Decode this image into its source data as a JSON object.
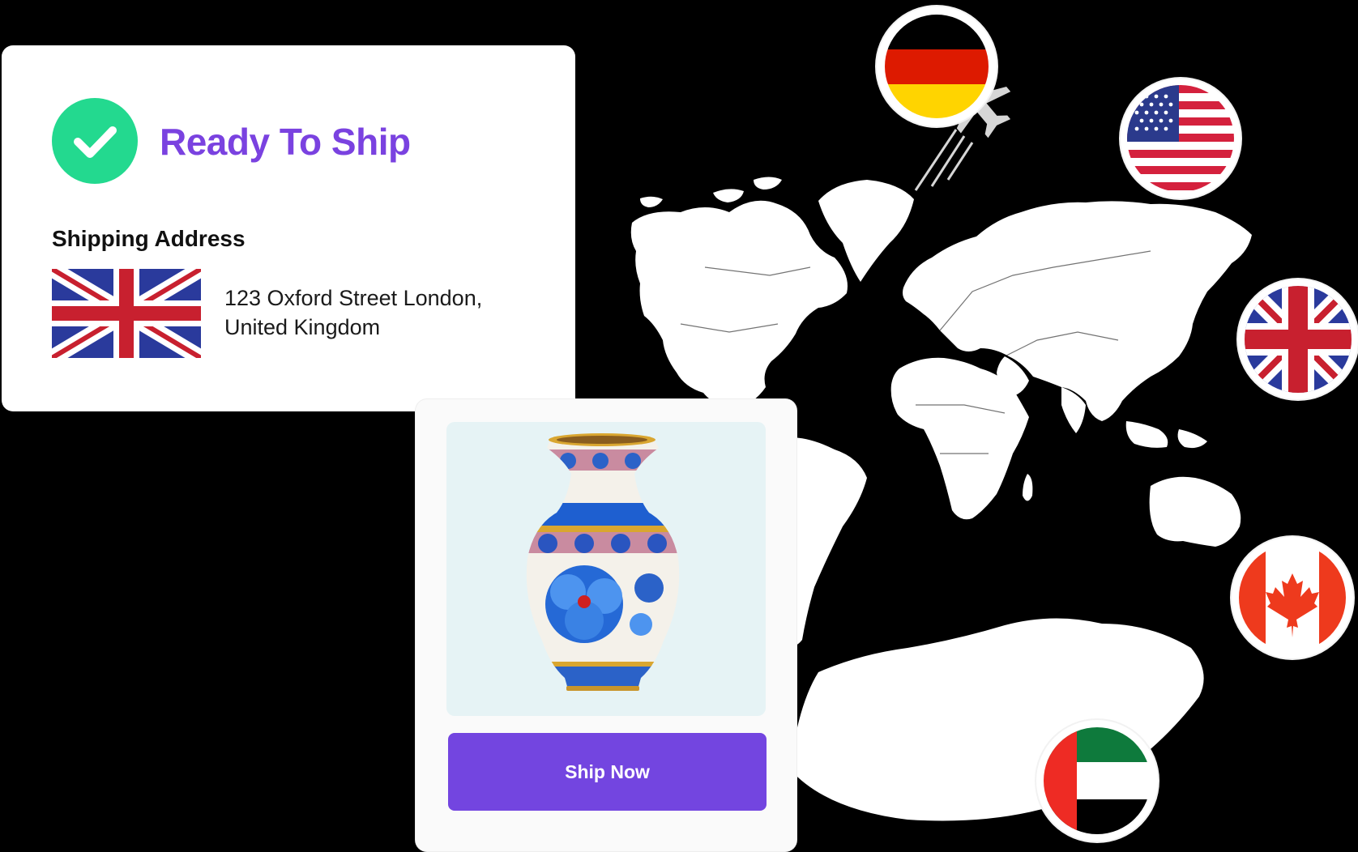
{
  "shipping_card": {
    "status_title": "Ready To Ship",
    "status_icon": "check-icon",
    "status_color": "#23d98f",
    "accent_color": "#7a42e0",
    "address_heading": "Shipping Address",
    "address_flag": "uk-flag-icon",
    "address_line1": "123 Oxford Street London,",
    "address_line2": "United Kingdom"
  },
  "product_card": {
    "image": "cloisonne-vase-image",
    "button_label": "Ship Now",
    "button_color": "#7345e0"
  },
  "destinations": [
    {
      "country": "Germany",
      "icon": "germany-flag-icon"
    },
    {
      "country": "United States",
      "icon": "usa-flag-icon"
    },
    {
      "country": "United Kingdom",
      "icon": "uk-flag-icon"
    },
    {
      "country": "Canada",
      "icon": "canada-flag-icon"
    },
    {
      "country": "United Arab Emirates",
      "icon": "uae-flag-icon"
    }
  ],
  "background": {
    "image": "world-map-image",
    "map_color": "#ffffff"
  }
}
